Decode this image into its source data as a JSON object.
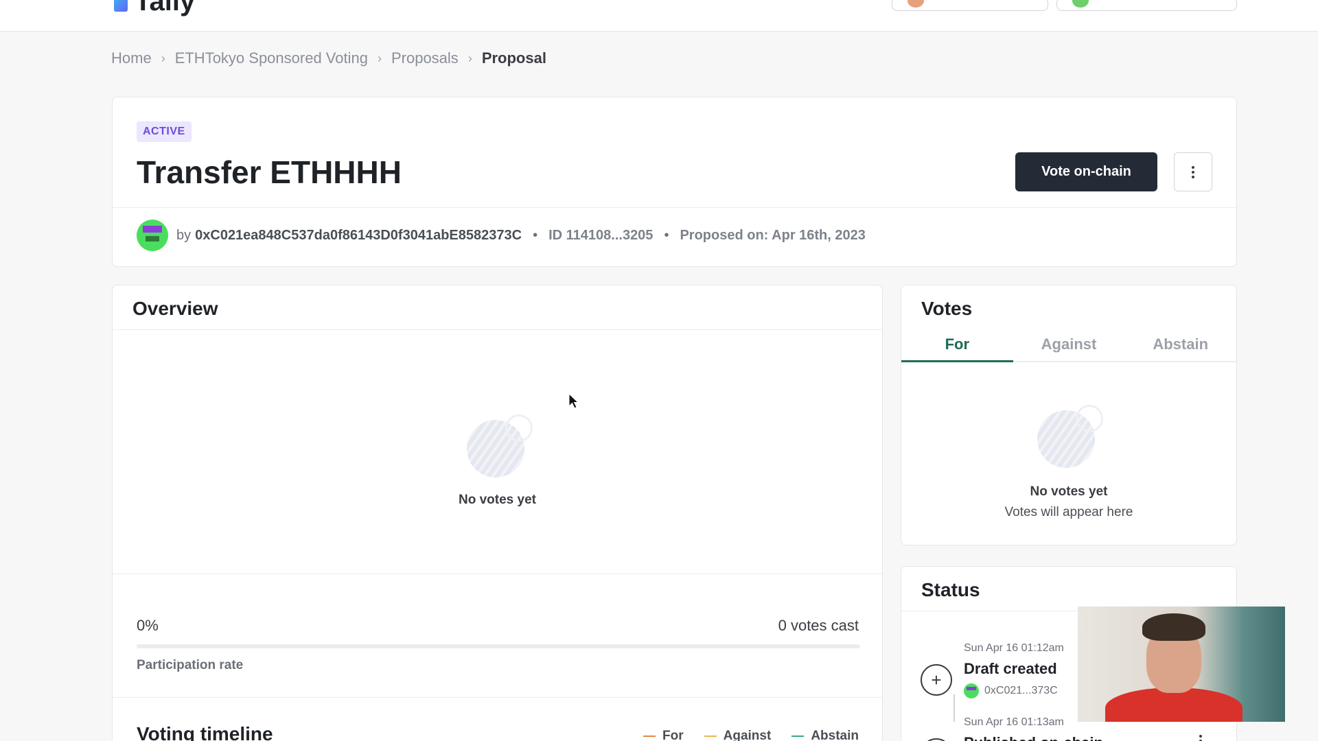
{
  "app": {
    "name": "Tally"
  },
  "breadcrumb": {
    "items": [
      "Home",
      "ETHTokyo Sponsored Voting",
      "Proposals"
    ],
    "current": "Proposal"
  },
  "proposal": {
    "status": "ACTIVE",
    "title": "Transfer ETHHHH",
    "vote_button": "Vote on-chain",
    "by_label": "by",
    "proposer": "0xC021ea848C537da0f86143D0f3041abE8582373C",
    "id_label": "ID 114108...3205",
    "proposed_on": "Proposed on: Apr 16th, 2023"
  },
  "overview": {
    "title": "Overview",
    "empty_text": "No votes yet",
    "participation_pct": "0%",
    "participation_value": 0,
    "votes_cast": "0 votes cast",
    "participation_label": "Participation rate",
    "timeline_title": "Voting timeline",
    "legend": [
      {
        "label": "For",
        "color": "#e28a4a"
      },
      {
        "label": "Against",
        "color": "#e6b94a"
      },
      {
        "label": "Abstain",
        "color": "#3aa889"
      }
    ]
  },
  "votes": {
    "title": "Votes",
    "tabs": [
      "For",
      "Against",
      "Abstain"
    ],
    "active_tab": "For",
    "empty_title": "No votes yet",
    "empty_sub": "Votes will appear here"
  },
  "status": {
    "title": "Status",
    "items": [
      {
        "time": "Sun Apr 16 01:12am",
        "title": "Draft created",
        "address": "0xC021...373C",
        "icon": "plus-icon"
      },
      {
        "time": "Sun Apr 16 01:13am",
        "title": "Published on-chain",
        "icon": "rocket-icon"
      }
    ]
  },
  "colors": {
    "accent_dark": "#242b36",
    "active_badge_bg": "#ece6ff",
    "active_badge_text": "#6d4bd9",
    "tab_active": "#1d6b56"
  }
}
